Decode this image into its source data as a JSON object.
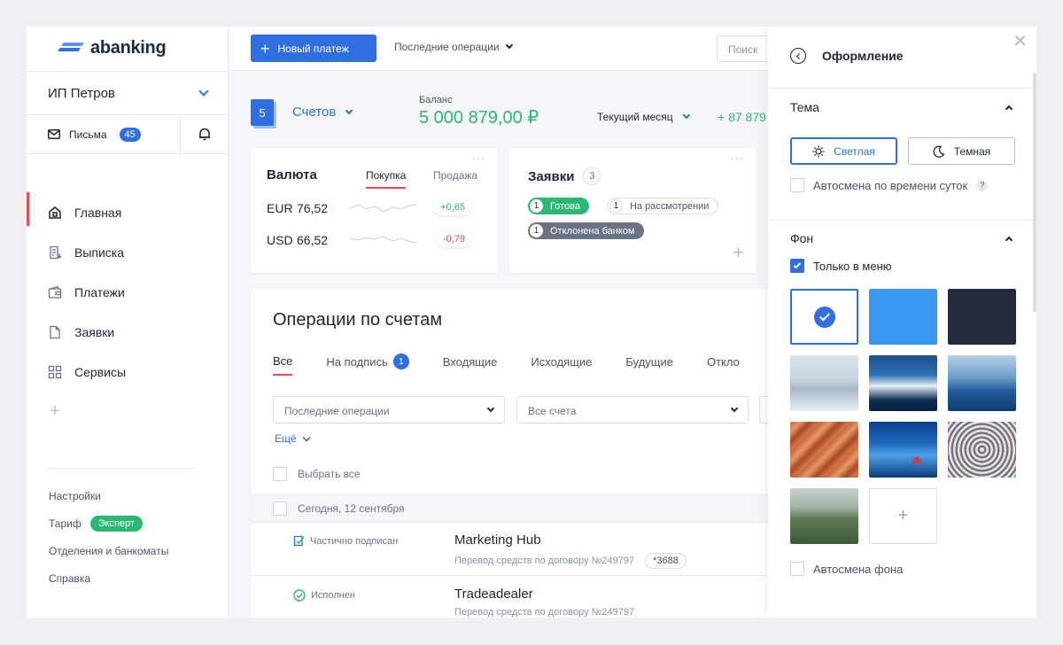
{
  "brand": {
    "name": "abanking"
  },
  "topbar": {
    "new_payment": "Новый платеж",
    "recent_ops": "Последние операции",
    "search_placeholder": "Поиск"
  },
  "sidebar": {
    "company": "ИП Петров",
    "letters_label": "Письма",
    "letters_count": "45",
    "nav": [
      {
        "label": "Главная",
        "icon": "home-icon",
        "active": true
      },
      {
        "label": "Выписка",
        "icon": "statement-icon"
      },
      {
        "label": "Платежи",
        "icon": "wallet-icon"
      },
      {
        "label": "Заявки",
        "icon": "document-icon"
      },
      {
        "label": "Сервисы",
        "icon": "grid-icon"
      }
    ],
    "links": {
      "settings": "Настройки",
      "tariff": "Тариф",
      "tariff_badge": "Эксперт",
      "branches": "Отделения и банкоматы",
      "help": "Справка"
    }
  },
  "summary": {
    "accounts_count": "5",
    "accounts_label": "Счетов",
    "balance_label": "Баланс",
    "balance_value": "5 000 879,00 ₽",
    "month_label": "Текущий месяц",
    "month_value": "+ 87 879"
  },
  "currency": {
    "title": "Валюта",
    "tab_buy": "Покупка",
    "tab_sell": "Продажа",
    "rows": [
      {
        "code": "EUR",
        "rate": "76,52",
        "change": "+0,65",
        "trend": "up"
      },
      {
        "code": "USD",
        "rate": "66,52",
        "change": "-0,79",
        "trend": "down"
      }
    ]
  },
  "requests": {
    "title": "Заявки",
    "count": "3",
    "items": [
      {
        "num": "1",
        "label": "Готова",
        "status": "green"
      },
      {
        "num": "1",
        "label": "На рассмотрении",
        "status": "grey"
      },
      {
        "num": "1",
        "label": "Отклонена банком",
        "status": "dark"
      }
    ]
  },
  "operations": {
    "title": "Операции по счетам",
    "tabs": [
      {
        "label": "Все",
        "active": true
      },
      {
        "label": "На подпись",
        "badge": "1"
      },
      {
        "label": "Входящие"
      },
      {
        "label": "Исходящие"
      },
      {
        "label": "Будущие"
      },
      {
        "label": "Откло"
      }
    ],
    "filter_period": "Последние операции",
    "filter_accounts": "Все счета",
    "more": "Ещё",
    "select_all": "Выбрать все",
    "day_label": "Сегодня, 12 сентября",
    "rows": [
      {
        "status": "Частично подписан",
        "status_icon": "partial-sign-icon",
        "name": "Marketing Hub",
        "desc": "Перевод средств по договору №249797",
        "account": "*3688"
      },
      {
        "status": "Исполнен",
        "status_icon": "done-icon",
        "name": "Tradeadealer",
        "desc": "Перевод средств по договору №249797",
        "account": ""
      }
    ]
  },
  "panel": {
    "title": "Оформление",
    "theme_title": "Тема",
    "theme_light": "Светлая",
    "theme_dark": "Темная",
    "theme_auto": "Автосмена по времени суток",
    "theme_auto_help": "?",
    "bg_title": "Фон",
    "bg_only_menu": "Только в меню",
    "bg_auto": "Автосмена фона",
    "colors": {
      "accent": "#2f6fe0",
      "blue_tile": "#3a98f0",
      "dark_tile": "#232a3a"
    }
  }
}
